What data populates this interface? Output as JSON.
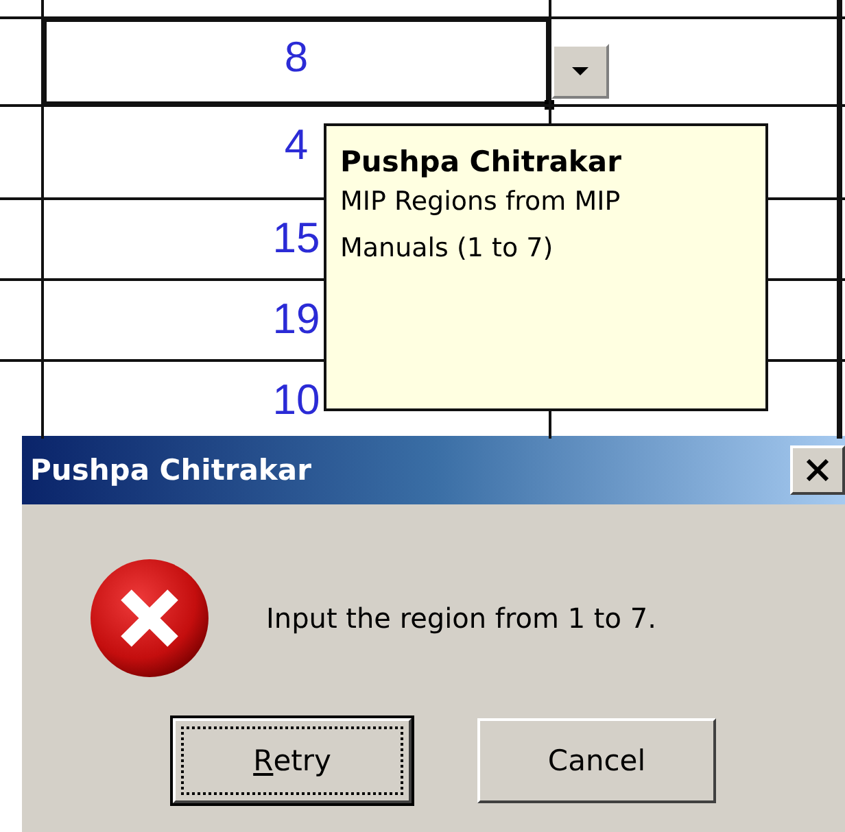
{
  "sheet": {
    "rows": [
      {
        "value": "8",
        "selected": true
      },
      {
        "value": "4",
        "selected": false
      },
      {
        "value": "15",
        "selected": false
      },
      {
        "value": "19",
        "selected": false
      },
      {
        "value": "10",
        "selected": false
      }
    ]
  },
  "comment": {
    "author": "Pushpa Chitrakar",
    "text": "MIP Regions from MIP\nManuals (1 to 7)"
  },
  "dialog": {
    "title": "Pushpa Chitrakar",
    "message": "Input the region from 1 to 7.",
    "buttons": [
      {
        "label": "Retry",
        "access_key_underlined": true,
        "focused": true
      },
      {
        "label": "Cancel",
        "focused": false
      }
    ]
  }
}
